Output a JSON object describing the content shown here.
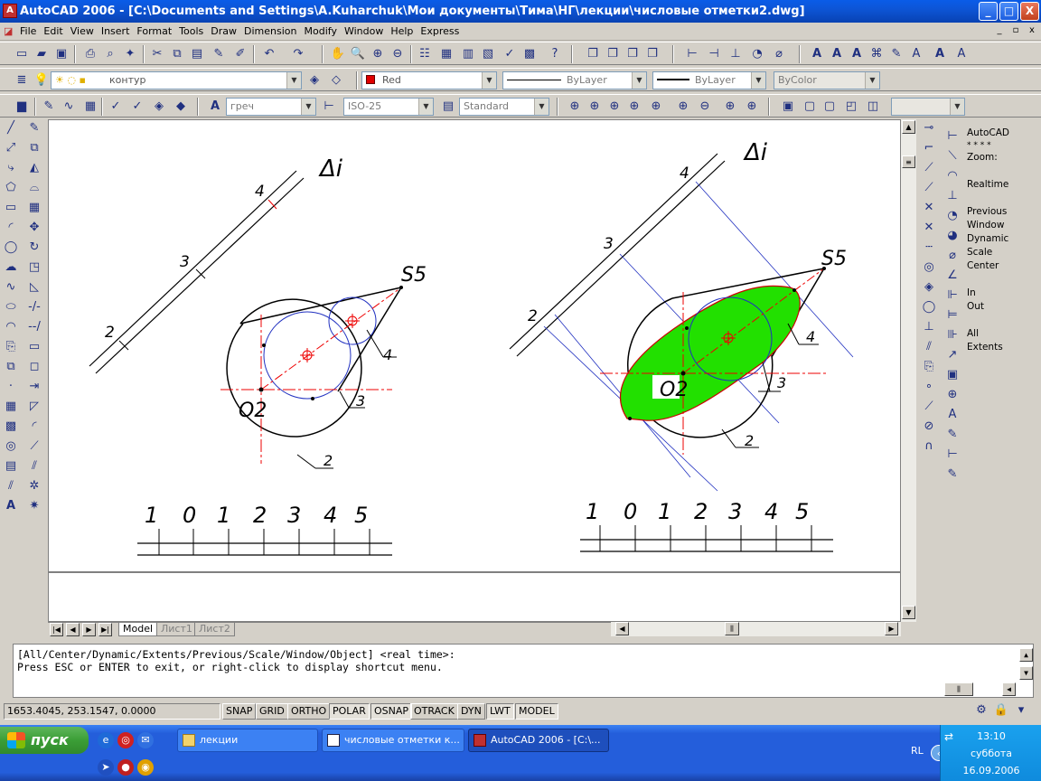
{
  "window": {
    "title": "AutoCAD 2006 - [C:\\Documents and Settings\\A.Kuharchuk\\Мои документы\\Тима\\НГ\\лекции\\числовые отметки2.dwg]",
    "btn_min": "_",
    "btn_max": "□",
    "btn_close": "X"
  },
  "menu": {
    "items": [
      "File",
      "Edit",
      "View",
      "Insert",
      "Format",
      "Tools",
      "Draw",
      "Dimension",
      "Modify",
      "Window",
      "Help",
      "Express"
    ],
    "mdi_min": "_",
    "mdi_restore": "▫",
    "mdi_close": "x"
  },
  "layers": {
    "current_layer": "контур",
    "color": "Red",
    "color_swatch": "#e00000",
    "linetype": "ByLayer",
    "lineweight": "ByLayer",
    "plotstyle": "ByColor"
  },
  "styles": {
    "text_style": "греч",
    "dim_style": "ISO-25",
    "table_style": "Standard"
  },
  "drawing": {
    "left": {
      "plane_label": "Δi",
      "point_label": "S5",
      "center_label": "O2",
      "line_labels": [
        "2",
        "3",
        "4"
      ],
      "callouts": [
        "4",
        "3",
        "2"
      ],
      "scale_labels": [
        "1",
        "0",
        "1",
        "2",
        "3",
        "4",
        "5"
      ]
    },
    "right": {
      "plane_label": "Δi",
      "point_label": "S5",
      "center_label": "O2",
      "line_labels": [
        "2",
        "3",
        "4"
      ],
      "callouts": [
        "4",
        "3",
        "2"
      ],
      "scale_labels": [
        "1",
        "0",
        "1",
        "2",
        "3",
        "4",
        "5"
      ],
      "fill_color": "#22e000"
    }
  },
  "layout_tabs": [
    "Model",
    "Лист1",
    "Лист2"
  ],
  "zoom_panel": [
    "AutoCAD",
    "* * * *",
    "Zoom:",
    "",
    "Realtime",
    "",
    "Previous",
    "Window",
    "Dynamic",
    "Scale",
    "Center",
    "",
    "In",
    "Out",
    "",
    "All",
    "Extents"
  ],
  "command": {
    "line1": "[All/Center/Dynamic/Extents/Previous/Scale/Window/Object] <real time>:",
    "line2": "Press ESC or ENTER to exit, or right-click to display shortcut menu."
  },
  "status": {
    "coords": "1653.4045, 253.1547, 0.0000",
    "buttons": [
      "SNAP",
      "GRID",
      "ORTHO",
      "POLAR",
      "OSNAP",
      "OTRACK",
      "DYN",
      "LWT",
      "MODEL"
    ],
    "on": [
      "POLAR",
      "OSNAP",
      "LWT",
      "MODEL"
    ]
  },
  "taskbar": {
    "start": "пуск",
    "tasks": [
      "лекции",
      "числовые отметки к...",
      "AutoCAD 2006 - [C:\\..."
    ],
    "lang": "RL",
    "time": "13:10",
    "day": "суббота",
    "date": "16.09.2006"
  }
}
